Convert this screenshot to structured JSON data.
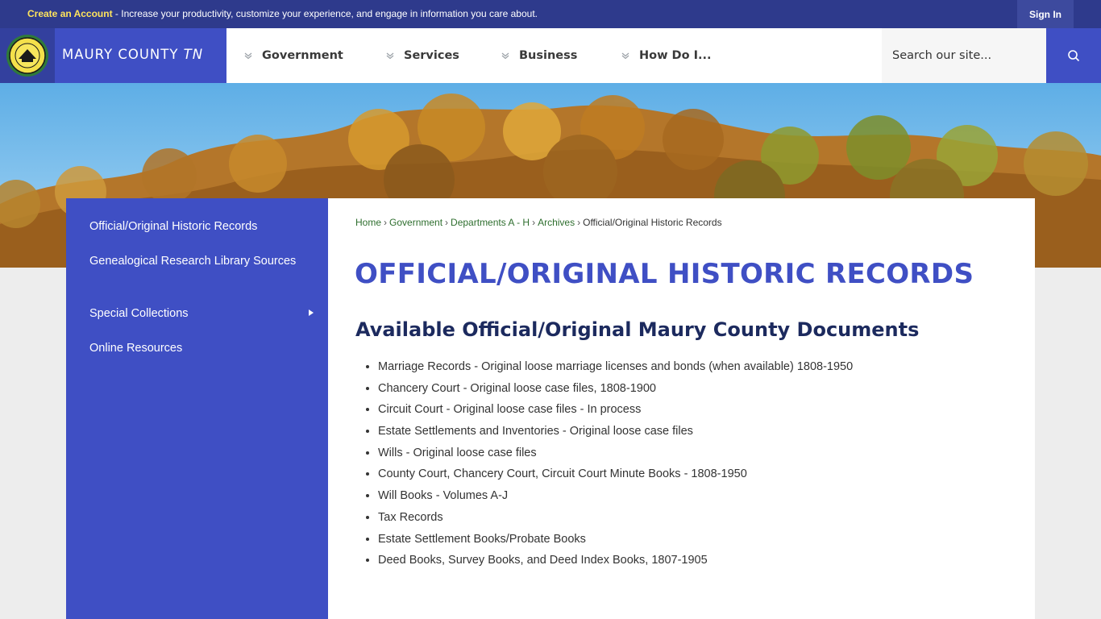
{
  "topbar": {
    "create_account_link": "Create an Account",
    "promo_text": " - Increase your productivity, customize your experience, and engage in information you care about.",
    "sign_in_label": "Sign In"
  },
  "header": {
    "site_name": "MAURY COUNTY",
    "site_suffix": "TN",
    "nav": [
      {
        "label": "Government"
      },
      {
        "label": "Services"
      },
      {
        "label": "Business"
      },
      {
        "label": "How Do I..."
      }
    ],
    "search_placeholder": "Search our site..."
  },
  "sidebar": {
    "items": [
      {
        "label": "Official/Original Historic Records"
      },
      {
        "label": "Genealogical Research Library Sources"
      },
      {
        "label": "Special Collections"
      },
      {
        "label": "Online Resources"
      }
    ]
  },
  "breadcrumb": {
    "items": [
      "Home",
      "Government",
      "Departments A - H",
      "Archives"
    ],
    "current": "Official/Original Historic Records"
  },
  "main": {
    "page_title": "OFFICIAL/ORIGINAL HISTORIC RECORDS",
    "section_title": "Available Official/Original Maury County Documents",
    "documents": [
      "Marriage Records - Original loose marriage licenses and bonds (when available) 1808-1950",
      "Chancery Court - Original loose case files, 1808-1900",
      "Circuit Court - Original loose case files - In process",
      "Estate Settlements and Inventories - Original loose case files",
      "Wills - Original loose case files",
      "County Court, Chancery Court, Circuit Court Minute Books - 1808-1950",
      "Will Books - Volumes A-J",
      "Tax Records",
      "Estate Settlement Books/Probate Books",
      "Deed Books, Survey Books, and Deed Index Books, 1807-1905"
    ]
  },
  "colors": {
    "primary_blue": "#3f4fc4",
    "topbar_navy": "#2e3a8c",
    "link_green": "#2e6e2e",
    "heading_navy": "#1c2a5e",
    "promo_yellow": "#ffe45c"
  },
  "icons": [
    "county-seal-logo",
    "chevron-down-icon",
    "search-icon",
    "submenu-arrow-icon"
  ]
}
